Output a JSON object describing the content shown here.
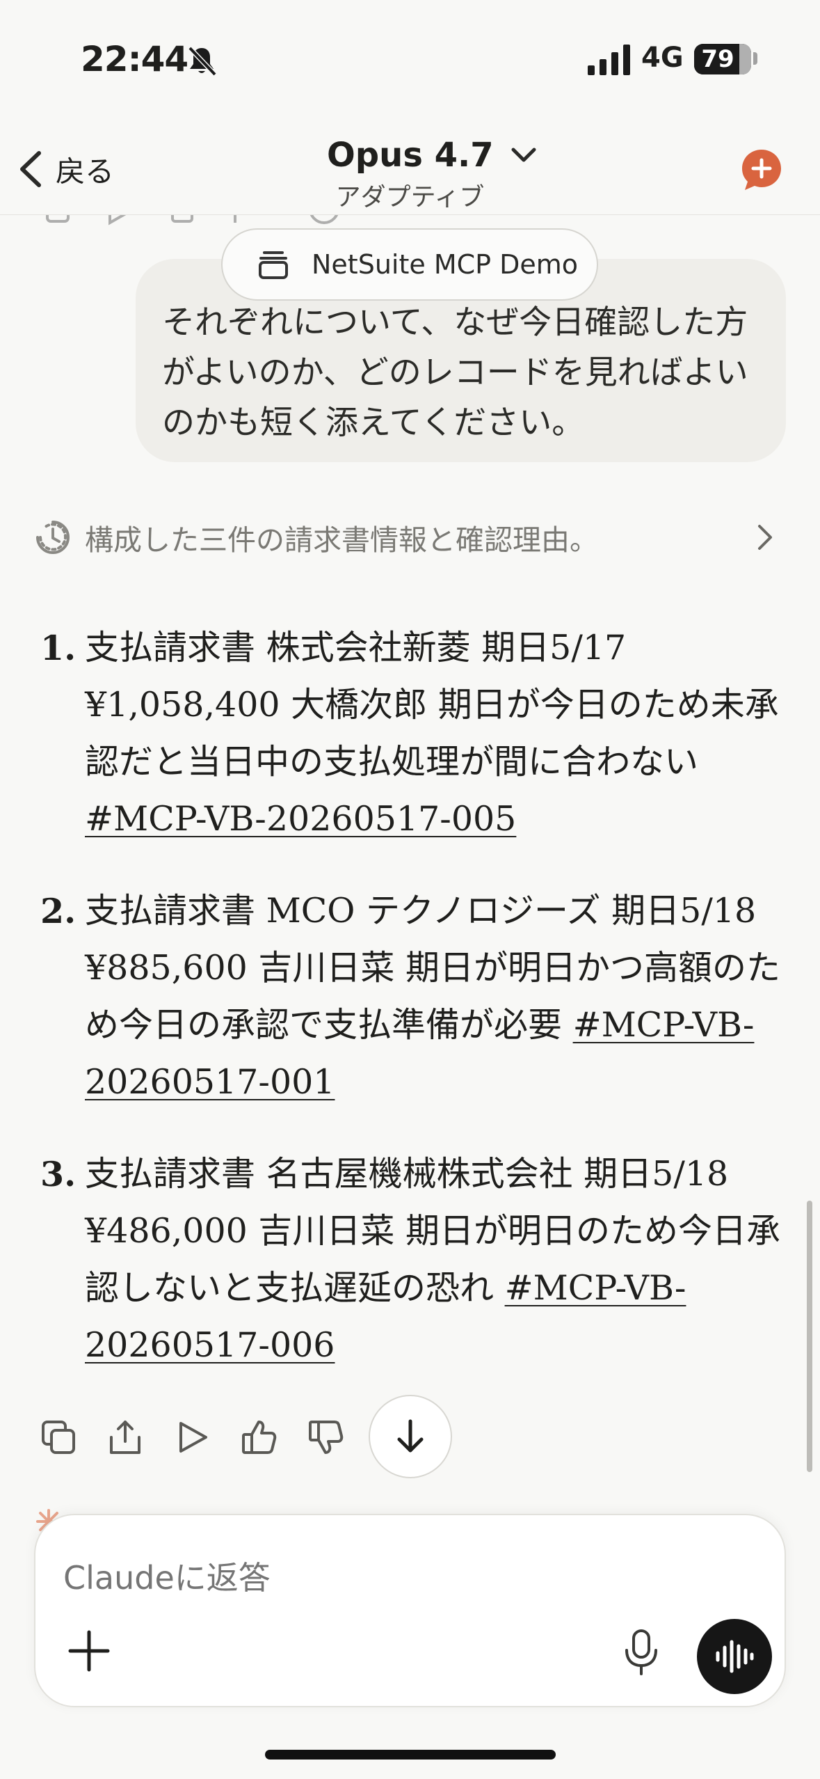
{
  "status_bar": {
    "time": "22:44",
    "network": "4G",
    "battery": "79",
    "icons": [
      "bell-slash-icon",
      "signal-bars-icon"
    ]
  },
  "nav": {
    "back_label": "戻る",
    "model_name": "Opus 4.7",
    "mode_label": "アダプティブ",
    "accent_color": "#d9643f"
  },
  "project": {
    "name": "NetSuite MCP Demo"
  },
  "user_message": {
    "text": "それぞれについて、なぜ今日確認した方がよいのか、どのレコードを見ればよいのかも短く添えてください。"
  },
  "thinking": {
    "summary": "構成した三件の請求書情報と確認理由。"
  },
  "answer_items": [
    {
      "number": "1.",
      "text": "支払請求書 株式会社新菱 期日5/17 ¥1,058,400 大橋次郎 期日が今日のため未承認だと当日中の支払処理が間に合わない ",
      "link": "#MCP-VB-20260517-005"
    },
    {
      "number": "2.",
      "text": "支払請求書 MCO テクノロジーズ 期日5/18 ¥885,600 吉川日菜 期日が明日かつ高額のため今日の承認で支払準備が必要 ",
      "link": "#MCP-VB-20260517-001"
    },
    {
      "number": "3.",
      "text": "支払請求書 名古屋機械株式会社 期日5/18 ¥486,000 吉川日菜 期日が明日のため今日承認しないと支払遅延の恐れ ",
      "link": "#MCP-VB-20260517-006"
    }
  ],
  "composer": {
    "placeholder": "Claudeに返答"
  }
}
